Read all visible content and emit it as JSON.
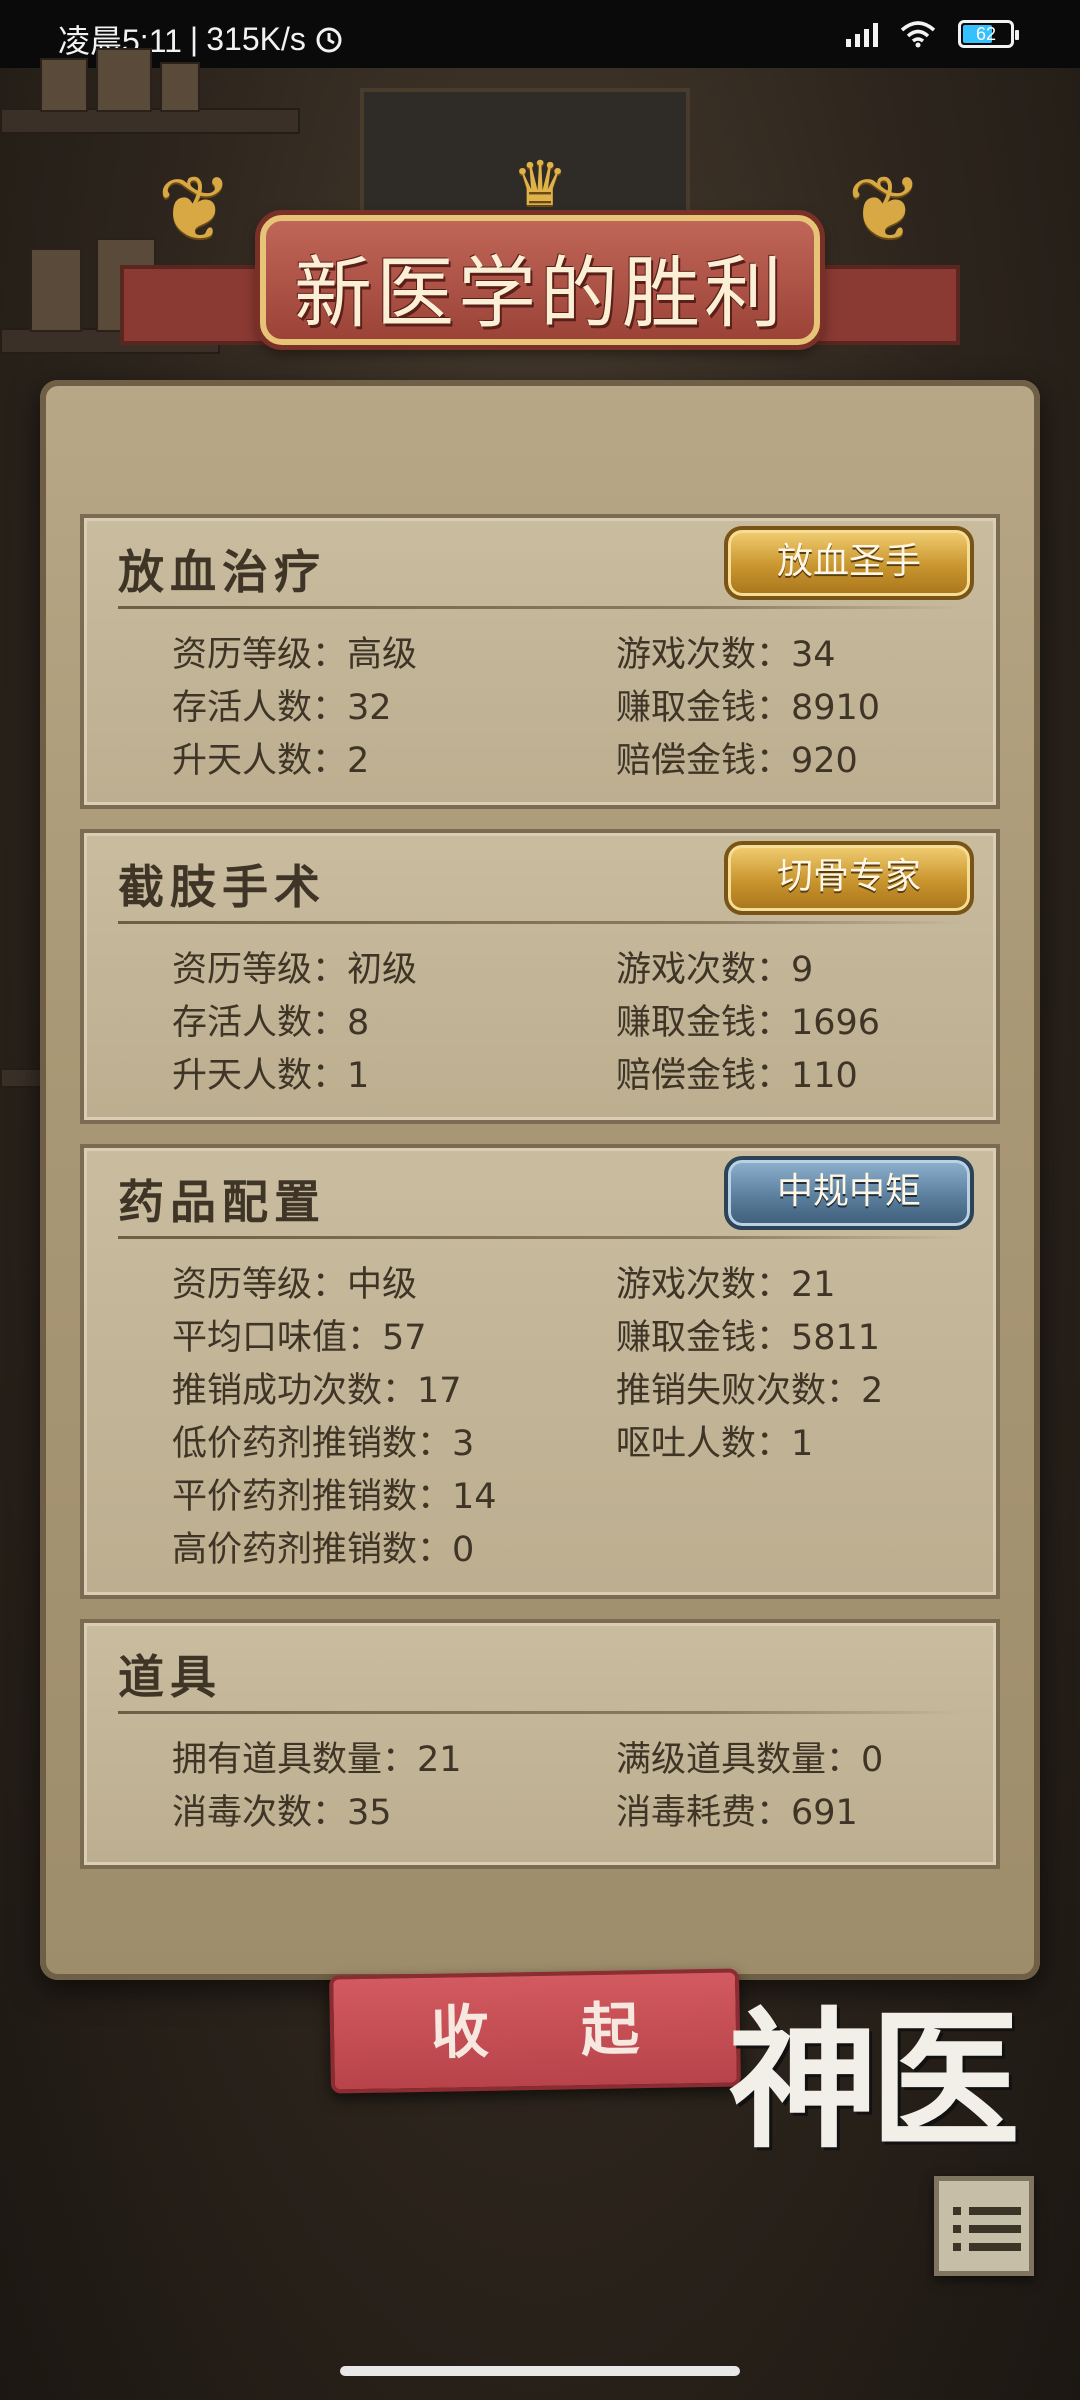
{
  "status_bar": {
    "time": "凌晨5:11",
    "speed": "315K/s",
    "battery": "62",
    "alarm_icon": "alarm-icon",
    "signal_icon": "signal-icon",
    "wifi_icon": "wifi-icon"
  },
  "title": "新医学的胜利",
  "sections": [
    {
      "title": "放血治疗",
      "badge": "放血圣手",
      "badge_color": "gold",
      "stats": [
        [
          "资历等级：高级",
          "游戏次数：34"
        ],
        [
          "存活人数：32",
          "赚取金钱：8910"
        ],
        [
          "升天人数：2",
          "赔偿金钱：920"
        ]
      ]
    },
    {
      "title": "截肢手术",
      "badge": "切骨专家",
      "badge_color": "gold",
      "stats": [
        [
          "资历等级：初级",
          "游戏次数：9"
        ],
        [
          "存活人数：8",
          "赚取金钱：1696"
        ],
        [
          "升天人数：1",
          "赔偿金钱：110"
        ]
      ]
    },
    {
      "title": "药品配置",
      "badge": "中规中矩",
      "badge_color": "blue",
      "stats": [
        [
          "资历等级：中级",
          "游戏次数：21"
        ],
        [
          "平均口味值：57",
          "赚取金钱：5811"
        ],
        [
          "推销成功次数：17",
          "推销失败次数：2"
        ],
        [
          "低价药剂推销数：3",
          "呕吐人数：1"
        ],
        [
          "平价药剂推销数：14",
          ""
        ],
        [
          "高价药剂推销数：0",
          ""
        ]
      ]
    },
    {
      "title": "道具",
      "stats": [
        [
          "拥有道具数量：21",
          "满级道具数量：0"
        ],
        [
          "消毒次数：35",
          "消毒耗费：691"
        ]
      ]
    }
  ],
  "collapse_button": "收 起",
  "logo": "神医",
  "menu_icon": "menu-list-icon"
}
